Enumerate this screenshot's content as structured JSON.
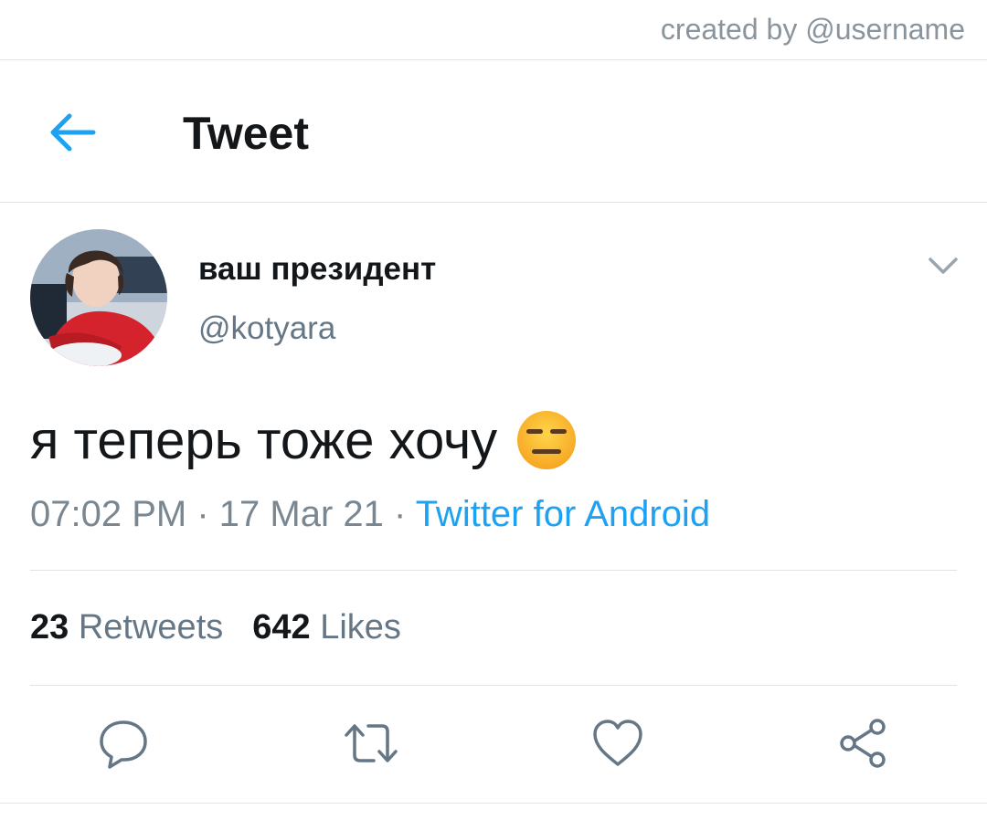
{
  "credit": "created by @username",
  "header": {
    "title": "Tweet",
    "back_icon": "arrow-left-icon"
  },
  "tweet": {
    "display_name": "ваш президент",
    "handle": "@kotyara",
    "text": "я теперь тоже хочу",
    "emoji": "expressionless-face-emoji",
    "time": "07:02 PM",
    "date": "17 Mar 21",
    "separator": " · ",
    "source": "Twitter for Android",
    "retweets_count": "23",
    "retweets_label": "Retweets",
    "likes_count": "642",
    "likes_label": "Likes"
  },
  "actions": [
    "reply-icon",
    "retweet-icon",
    "like-icon",
    "share-icon"
  ],
  "colors": {
    "accent": "#1da1f2",
    "text": "#14171a",
    "secondary": "#657786",
    "divider": "#e1e4e7"
  }
}
